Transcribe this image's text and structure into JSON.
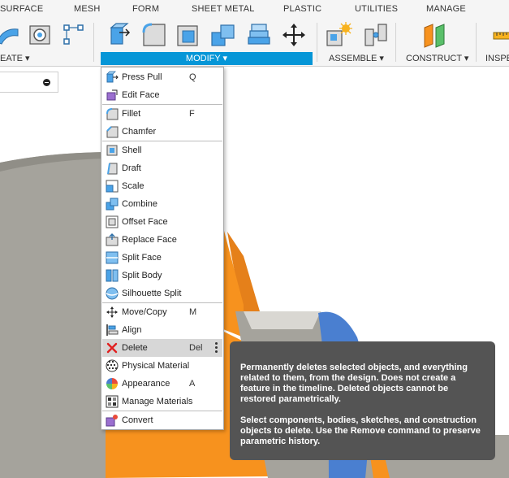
{
  "ribbon": {
    "tabs": [
      "SURFACE",
      "MESH",
      "FORM",
      "SHEET METAL",
      "PLASTIC",
      "UTILITIES",
      "MANAGE"
    ],
    "groups": {
      "create": "EATE",
      "modify": "MODIFY",
      "assemble": "ASSEMBLE",
      "construct": "CONSTRUCT",
      "inspect": "INSPE"
    }
  },
  "menu": {
    "items": [
      {
        "label": "Press Pull",
        "key": "Q",
        "icon": "press-pull-icon"
      },
      {
        "label": "Edit Face",
        "key": "",
        "icon": "edit-face-icon"
      },
      {
        "label": "Fillet",
        "key": "F",
        "icon": "fillet-icon"
      },
      {
        "label": "Chamfer",
        "key": "",
        "icon": "chamfer-icon"
      },
      {
        "label": "Shell",
        "key": "",
        "icon": "shell-icon"
      },
      {
        "label": "Draft",
        "key": "",
        "icon": "draft-icon"
      },
      {
        "label": "Scale",
        "key": "",
        "icon": "scale-icon"
      },
      {
        "label": "Combine",
        "key": "",
        "icon": "combine-icon"
      },
      {
        "label": "Offset Face",
        "key": "",
        "icon": "offset-face-icon"
      },
      {
        "label": "Replace Face",
        "key": "",
        "icon": "replace-face-icon"
      },
      {
        "label": "Split Face",
        "key": "",
        "icon": "split-face-icon"
      },
      {
        "label": "Split Body",
        "key": "",
        "icon": "split-body-icon"
      },
      {
        "label": "Silhouette Split",
        "key": "",
        "icon": "silhouette-split-icon"
      },
      {
        "label": "Move/Copy",
        "key": "M",
        "icon": "move-copy-icon"
      },
      {
        "label": "Align",
        "key": "",
        "icon": "align-icon"
      },
      {
        "label": "Delete",
        "key": "Del",
        "icon": "delete-icon"
      },
      {
        "label": "Physical Material",
        "key": "",
        "icon": "physical-material-icon"
      },
      {
        "label": "Appearance",
        "key": "A",
        "icon": "appearance-icon"
      },
      {
        "label": "Manage Materials",
        "key": "",
        "icon": "manage-materials-icon"
      },
      {
        "label": "Convert",
        "key": "",
        "icon": "convert-icon"
      }
    ]
  },
  "tooltip": {
    "paragraph1": "Permanently deletes selected objects, and everything related to them, from the design. Does not create a feature in the timeline. Deleted objects cannot be restored parametrically.",
    "paragraph2": "Select components, bodies, sketches, and construction objects to delete. Use the Remove command to preserve parametric history."
  },
  "colors": {
    "accent": "#0696d7",
    "tooltip_bg": "#545454",
    "body_orange": "#f7921e",
    "body_grey": "#a5a39c",
    "face_blue": "#4a7fd0"
  }
}
